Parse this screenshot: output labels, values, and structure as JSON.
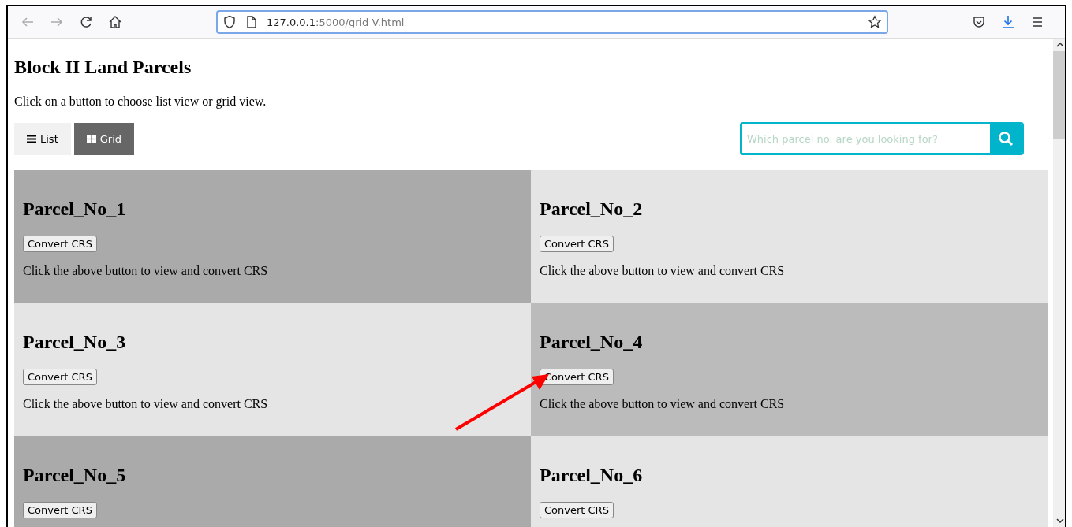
{
  "browser": {
    "url": {
      "host": "127.0.0.1",
      "path": ":5000/grid V.html"
    }
  },
  "page": {
    "title": "Block II Land Parcels",
    "intro": "Click on a button to choose list view or grid view.",
    "views": [
      {
        "label": "List",
        "kind": "list",
        "selected": false
      },
      {
        "label": "Grid",
        "kind": "grid",
        "selected": true
      }
    ],
    "search": {
      "placeholder": "Which parcel no. are you looking for?"
    },
    "parcels": [
      {
        "name": "Parcel_No_1",
        "button": "Convert CRS",
        "text": "Click the above button to view and convert CRS",
        "color": "#aaaaaa"
      },
      {
        "name": "Parcel_No_2",
        "button": "Convert CRS",
        "text": "Click the above button to view and convert CRS",
        "color": "#e5e5e5"
      },
      {
        "name": "Parcel_No_3",
        "button": "Convert CRS",
        "text": "Click the above button to view and convert CRS",
        "color": "#e5e5e5"
      },
      {
        "name": "Parcel_No_4",
        "button": "Convert CRS",
        "text": "Click the above button to view and convert CRS",
        "color": "#bbbbbb"
      },
      {
        "name": "Parcel_No_5",
        "button": "Convert CRS",
        "color": "#aaaaaa"
      },
      {
        "name": "Parcel_No_6",
        "button": "Convert CRS",
        "color": "#e5e5e5"
      }
    ]
  }
}
